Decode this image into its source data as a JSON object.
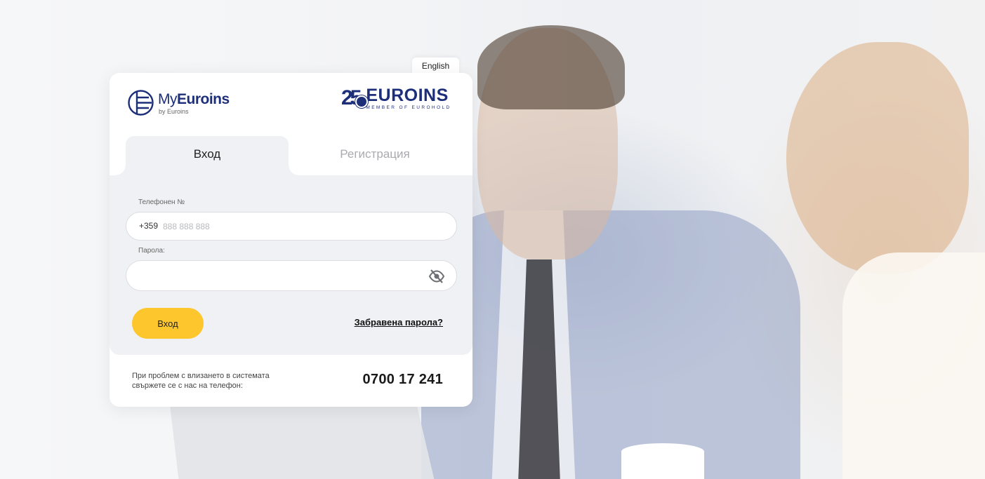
{
  "language_tab": {
    "label": "English"
  },
  "logos": {
    "myeuroins_brand_prefix": "My",
    "myeuroins_brand_bold": "Euroins",
    "myeuroins_sub": "by Euroins",
    "euroins_number": "25",
    "euroins_name": "EUROINS",
    "euroins_member": "MEMBER OF EUROHOLD"
  },
  "tabs": {
    "login": "Вход",
    "register": "Регистрация"
  },
  "form": {
    "phone_label": "Телефонен №",
    "phone_prefix": "+359",
    "phone_placeholder": "888 888 888",
    "phone_value": "",
    "password_label": "Парола:",
    "password_value": "",
    "submit_label": "Вход",
    "forgot_label": "Забравена парола?"
  },
  "footer": {
    "help_text": "При проблем с влизането в системата свържете се с нас на телефон:",
    "support_phone": "0700 17 241"
  },
  "colors": {
    "accent": "#fdc62d",
    "brand": "#1e2f7a",
    "panel": "#f0f1f4"
  }
}
